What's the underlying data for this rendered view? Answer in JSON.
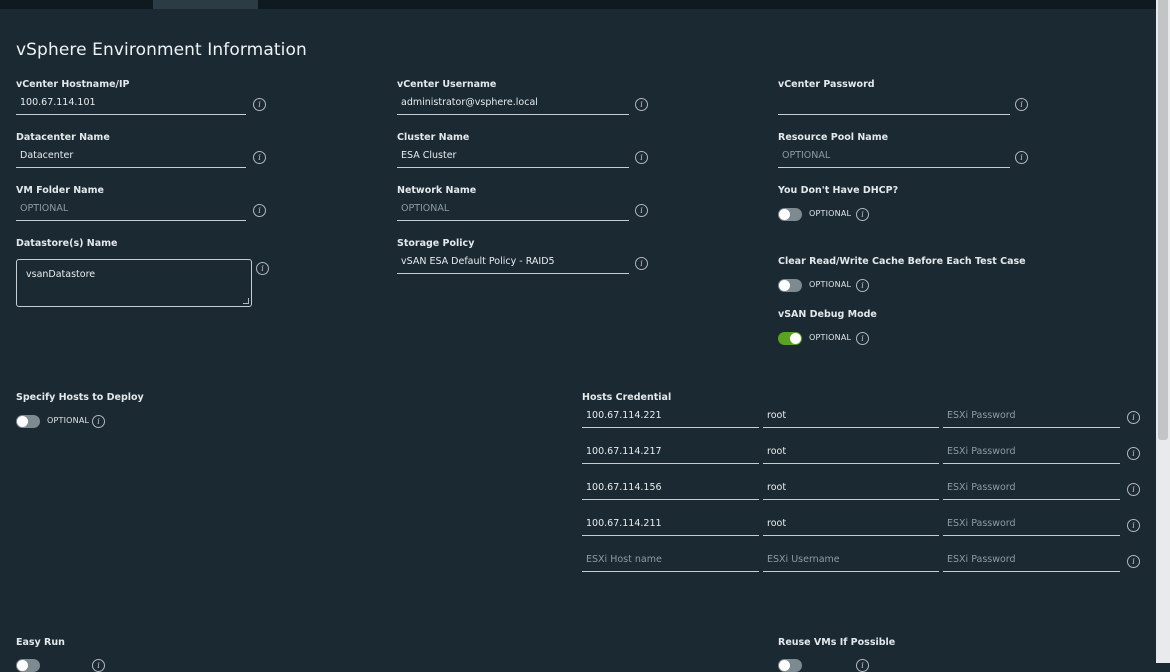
{
  "section": {
    "title": "vSphere Environment Information"
  },
  "vcenter_hostname": {
    "label": "vCenter Hostname/IP",
    "value": "100.67.114.101"
  },
  "vcenter_username": {
    "label": "vCenter Username",
    "value": "administrator@vsphere.local"
  },
  "vcenter_password": {
    "label": "vCenter Password",
    "value": ""
  },
  "datacenter_name": {
    "label": "Datacenter Name",
    "value": "Datacenter"
  },
  "cluster_name": {
    "label": "Cluster Name",
    "value": "ESA Cluster"
  },
  "resource_pool": {
    "label": "Resource Pool Name",
    "placeholder": "OPTIONAL"
  },
  "vm_folder": {
    "label": "VM Folder Name",
    "placeholder": "OPTIONAL"
  },
  "network_name": {
    "label": "Network Name",
    "placeholder": "OPTIONAL"
  },
  "no_dhcp": {
    "label": "You Don't Have DHCP?",
    "toggle_text": "OPTIONAL",
    "on": false
  },
  "datastore": {
    "label": "Datastore(s) Name",
    "value": "vsanDatastore"
  },
  "storage_policy": {
    "label": "Storage Policy",
    "value": "vSAN ESA Default Policy - RAID5"
  },
  "clear_cache": {
    "label": "Clear Read/Write Cache Before Each Test Case",
    "toggle_text": "OPTIONAL",
    "on": false
  },
  "vsan_debug": {
    "label": "vSAN Debug Mode",
    "toggle_text": "OPTIONAL",
    "on": true
  },
  "specify_hosts": {
    "label": "Specify Hosts to Deploy",
    "toggle_text": "OPTIONAL",
    "on": false
  },
  "hosts_credential": {
    "label": "Hosts Credential",
    "rows": [
      {
        "host": "100.67.114.221",
        "user": "root",
        "password_placeholder": "ESXi Password"
      },
      {
        "host": "100.67.114.217",
        "user": "root",
        "password_placeholder": "ESXi Password"
      },
      {
        "host": "100.67.114.156",
        "user": "root",
        "password_placeholder": "ESXi Password"
      },
      {
        "host": "100.67.114.211",
        "user": "root",
        "password_placeholder": "ESXi Password"
      }
    ],
    "new_row": {
      "host_placeholder": "ESXi Host name",
      "user_placeholder": "ESXi Username",
      "password_placeholder": "ESXi Password"
    }
  },
  "easy_run": {
    "label": "Easy Run",
    "on": false
  },
  "reuse_vms": {
    "label": "Reuse VMs If Possible",
    "on": false
  },
  "icons": {
    "info": "info-circle-icon"
  },
  "colors": {
    "background": "#1b2a32",
    "toggle_on": "#5aa220",
    "toggle_off": "#7d8a90"
  }
}
